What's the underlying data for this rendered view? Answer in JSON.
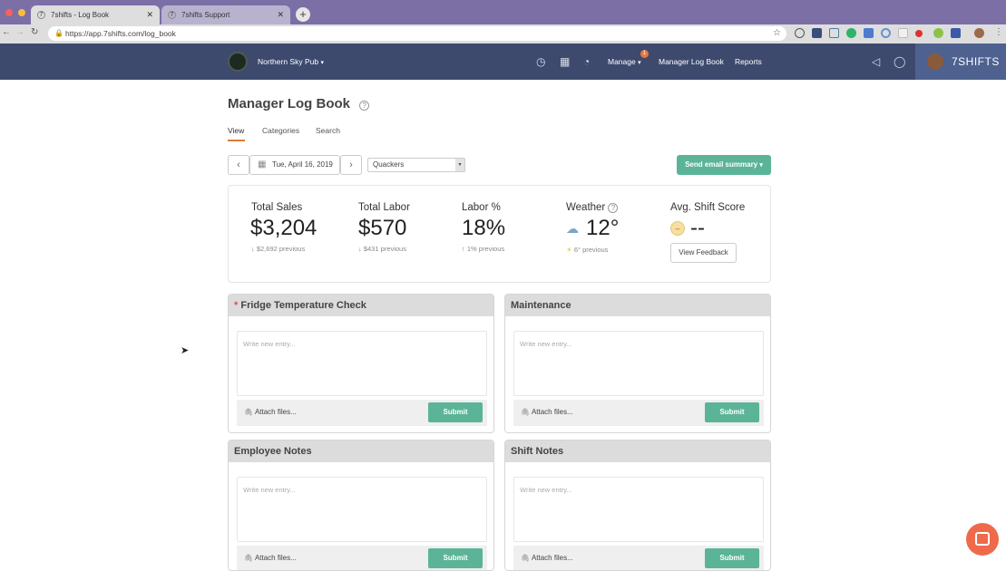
{
  "browser": {
    "tabs": [
      {
        "title": "7shifts - Log Book",
        "favicon": "7"
      },
      {
        "title": "7shifts Support",
        "favicon": "7"
      }
    ],
    "new_tab": "+",
    "url": "https://app.7shifts.com/log_book"
  },
  "header": {
    "location": "Northern Sky Pub",
    "manage_label": "Manage",
    "manage_badge": "1",
    "log_book_label": "Manager Log Book",
    "reports_label": "Reports",
    "brand": "7SHIFTS"
  },
  "page": {
    "title": "Manager Log Book",
    "tabs": [
      "View",
      "Categories",
      "Search"
    ]
  },
  "toolbar": {
    "date": "Tue, April 16, 2019",
    "location_select": "Quackers",
    "email_summary": "Send email summary"
  },
  "kpis": {
    "sales": {
      "label": "Total Sales",
      "value": "$3,204",
      "previous": "$2,692 previous"
    },
    "labor": {
      "label": "Total Labor",
      "value": "$570",
      "previous": "$431 previous"
    },
    "labor_pct": {
      "label": "Labor %",
      "value": "18%",
      "previous": "1% previous"
    },
    "weather": {
      "label": "Weather",
      "value": "12°",
      "previous": "6° previous"
    },
    "shift_score": {
      "label": "Avg. Shift Score",
      "value": "--",
      "feedback_button": "View Feedback"
    }
  },
  "entry_common": {
    "placeholder": "Write new entry...",
    "attach": "Attach files...",
    "submit": "Submit"
  },
  "panels": [
    {
      "title": "Fridge Temperature Check",
      "required_mark": "*"
    },
    {
      "title": "Maintenance"
    },
    {
      "title": "Employee Notes"
    },
    {
      "title": "Shift Notes"
    }
  ],
  "colors": {
    "app_header": "#3d4a6e",
    "accent_green": "#5bb497",
    "tab_active": "#e07b39"
  }
}
